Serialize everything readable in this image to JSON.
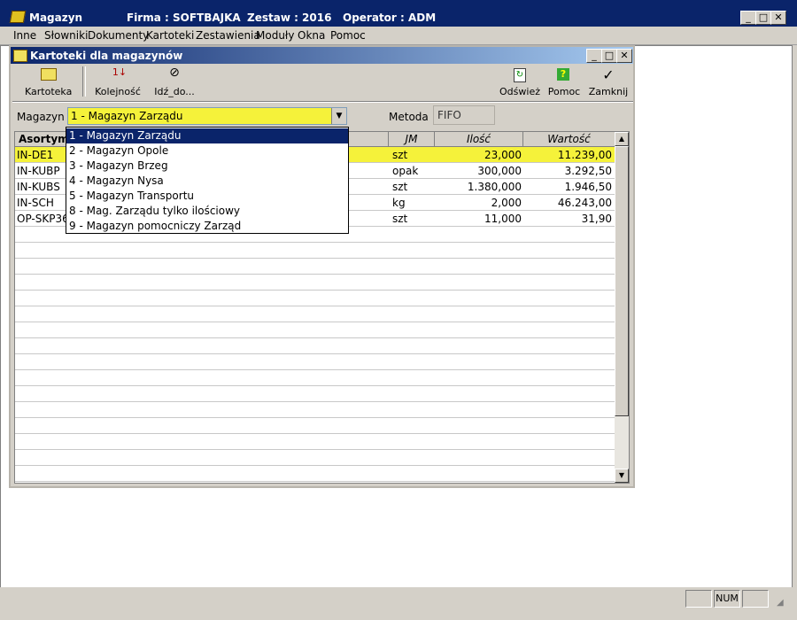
{
  "app": {
    "title": "Magazyn",
    "firma": "Firma : SOFTBAJKA",
    "zestaw": "Zestaw : 2016",
    "operator": "Operator : ADM",
    "window_buttons": [
      "_",
      "□",
      "✕"
    ]
  },
  "menu": [
    "Inne",
    "Słowniki",
    "Dokumenty",
    "Kartoteki",
    "Zestawienia",
    "Moduły",
    "Okna",
    "Pomoc"
  ],
  "child_window": {
    "title": "Kartoteki dla magazynów",
    "buttons": [
      "_",
      "□",
      "✕"
    ]
  },
  "toolbar": {
    "kartoteka": "Kartoteka",
    "kolejnosc": "Kolejność",
    "idz_do": "Idź_do...",
    "odswiez": "Odśwież",
    "pomoc": "Pomoc",
    "zamknij": "Zamknij"
  },
  "filter": {
    "magazyn_label": "Magazyn",
    "magazyn_value": "1 - Magazyn Zarządu",
    "metoda_label": "Metoda",
    "metoda_value": "FIFO"
  },
  "dropdown_options": [
    "1 - Magazyn Zarządu",
    "2 - Magazyn Opole",
    "3 - Magazyn Brzeg",
    "4 - Magazyn Nysa",
    "5 - Magazyn Transportu",
    "8 - Mag. Zarządu tylko ilościowy",
    "9 - Magazyn pomocniczy Zarząd"
  ],
  "table": {
    "columns": [
      "Asortyme",
      "JM",
      "Ilość",
      "Wartość"
    ],
    "rows": [
      {
        "asortyment": "IN-DE1",
        "jm": "szt",
        "ilosc": "23,000",
        "wartosc": "11.239,00",
        "highlighted": true
      },
      {
        "asortyment": "IN-KUBP",
        "jm": "opak",
        "ilosc": "300,000",
        "wartosc": "3.292,50"
      },
      {
        "asortyment": "IN-KUBS",
        "jm": "szt",
        "ilosc": "1.380,000",
        "wartosc": "1.946,50"
      },
      {
        "asortyment": "IN-SCH",
        "jm": "kg",
        "ilosc": "2,000",
        "wartosc": "46.243,00"
      },
      {
        "asortyment": "OP-SKP36",
        "jm": "szt",
        "ilosc": "11,000",
        "wartosc": "31,90"
      }
    ]
  },
  "status_bar": {
    "num": "NUM"
  },
  "colors": {
    "title_bar": "#0a246a",
    "highlight_yellow": "#f5f23a",
    "selection_blue": "#0a246a"
  }
}
